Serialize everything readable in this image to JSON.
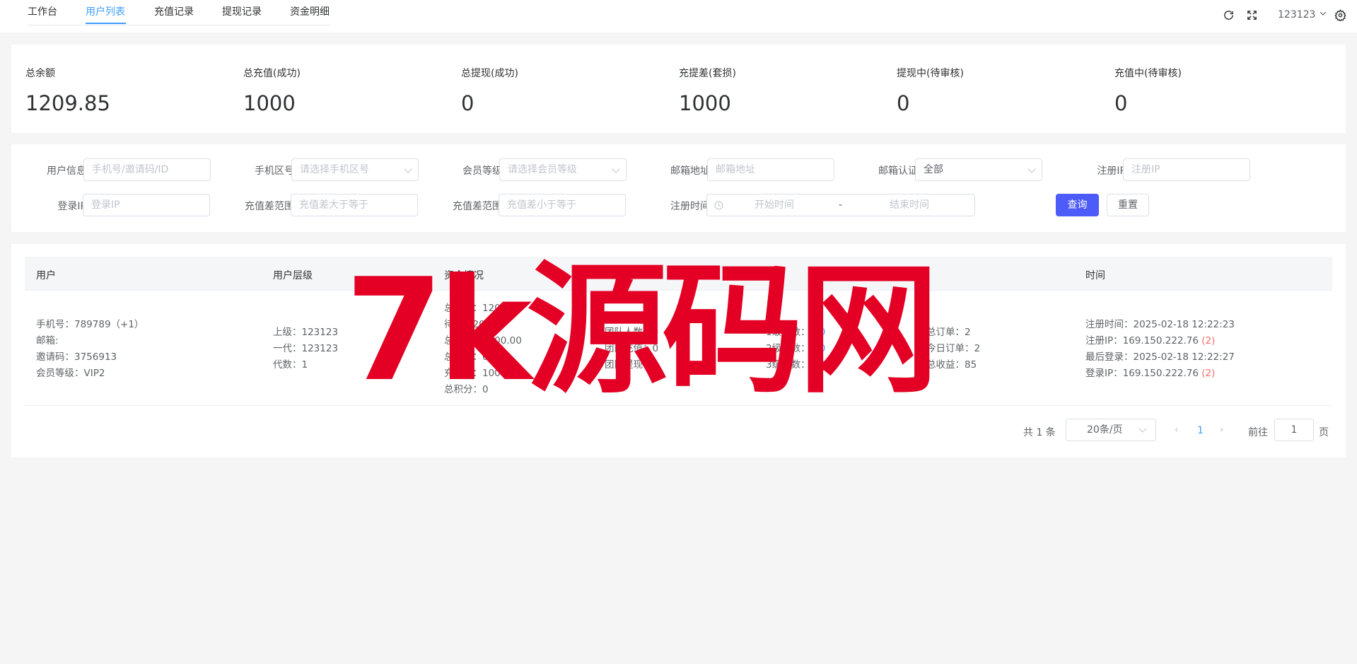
{
  "tabs": [
    "工作台",
    "用户列表",
    "充值记录",
    "提现记录",
    "资金明细"
  ],
  "header": {
    "user": "123123",
    "refresh_icon": "refresh-icon",
    "fullscreen_icon": "fullscreen-icon",
    "settings_icon": "gear-icon"
  },
  "stats": [
    {
      "label": "总余额",
      "value": "1209.85"
    },
    {
      "label": "总充值(成功)",
      "value": "1000"
    },
    {
      "label": "总提现(成功)",
      "value": "0"
    },
    {
      "label": "充提差(套损)",
      "value": "1000"
    },
    {
      "label": "提现中(待审核)",
      "value": "0"
    },
    {
      "label": "充值中(待审核)",
      "value": "0"
    }
  ],
  "filters": {
    "user_info_label": "用户信息",
    "user_info_placeholder": "手机号/邀请码/ID",
    "area_label": "手机区号",
    "area_placeholder": "请选择手机区号",
    "vip_label": "会员等级",
    "vip_placeholder": "请选择会员等级",
    "email_label": "邮箱地址",
    "email_placeholder": "邮箱地址",
    "email_verify_label": "邮箱认证",
    "email_verify_value": "全部",
    "reg_ip_label": "注册IP",
    "reg_ip_placeholder": "注册IP",
    "login_ip_label": "登录IP",
    "login_ip_placeholder": "登录IP",
    "diff_min_label": "充值差范围",
    "diff_min_placeholder": "充值差大于等于",
    "diff_max_label": "充值差范围",
    "diff_max_placeholder": "充值差小于等于",
    "reg_time_label": "注册时间",
    "start_placeholder": "开始时间",
    "range_sep": "-",
    "end_placeholder": "结束时间",
    "search_button": "查询",
    "reset_button": "重置"
  },
  "table": {
    "headers": [
      "用户",
      "用户层级",
      "资金情况",
      "",
      "",
      "",
      "时间"
    ],
    "row": {
      "user": [
        "手机号：789789（+1）",
        "邮箱:",
        "邀请码：3756913",
        "会员等级：VIP2"
      ],
      "level": [
        "上级：123123",
        "一代：123123",
        "代数：1"
      ],
      "funds": [
        "总余额：1209.85",
        "待领：209.85",
        "总充值：1000.00",
        "总提现：0",
        "充提差：1000",
        "总积分：0"
      ],
      "team": [
        "团队人数：0",
        "团队充值：0",
        "团队提现：0"
      ],
      "sub_levels": {
        "l1": "1级人数：",
        "l1_val": "0/0",
        "l2": "2级人数：",
        "l2_val": "0/0",
        "l3": "3级人数：",
        "l3_val": "0/0"
      },
      "orders": [
        "总订单：2",
        "今日订单：2",
        "总收益：85"
      ],
      "time": {
        "reg_time": "注册时间：2025-02-18 12:22:23",
        "reg_ip": "注册IP：169.150.222.76 ",
        "reg_ip_count": "(2)",
        "last_login": "最后登录：2025-02-18 12:22:27",
        "login_ip": "登录IP：169.150.222.76 ",
        "login_ip_count": "(2)"
      }
    }
  },
  "pager": {
    "total": "共 1 条",
    "size": "20条/页",
    "current": "1",
    "goto_label": "前往",
    "goto_value": "1",
    "page_suffix": "页"
  },
  "watermark": "7k源码网"
}
